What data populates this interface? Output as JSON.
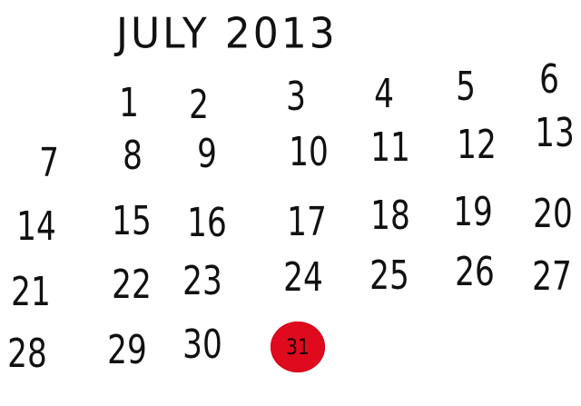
{
  "calendar": {
    "title": "JULY 2013",
    "marker_color": "#e00a1f",
    "week1": [
      "1",
      "2",
      "3",
      "4",
      "5",
      "6"
    ],
    "week2": [
      "7",
      "8",
      "9",
      "10",
      "11",
      "12",
      "13"
    ],
    "week3": [
      "14",
      "15",
      "16",
      "17",
      "18",
      "19",
      "20"
    ],
    "week4": [
      "21",
      "22",
      "23",
      "24",
      "25",
      "26",
      "27"
    ],
    "week5": [
      "28",
      "29",
      "30",
      "31"
    ]
  }
}
